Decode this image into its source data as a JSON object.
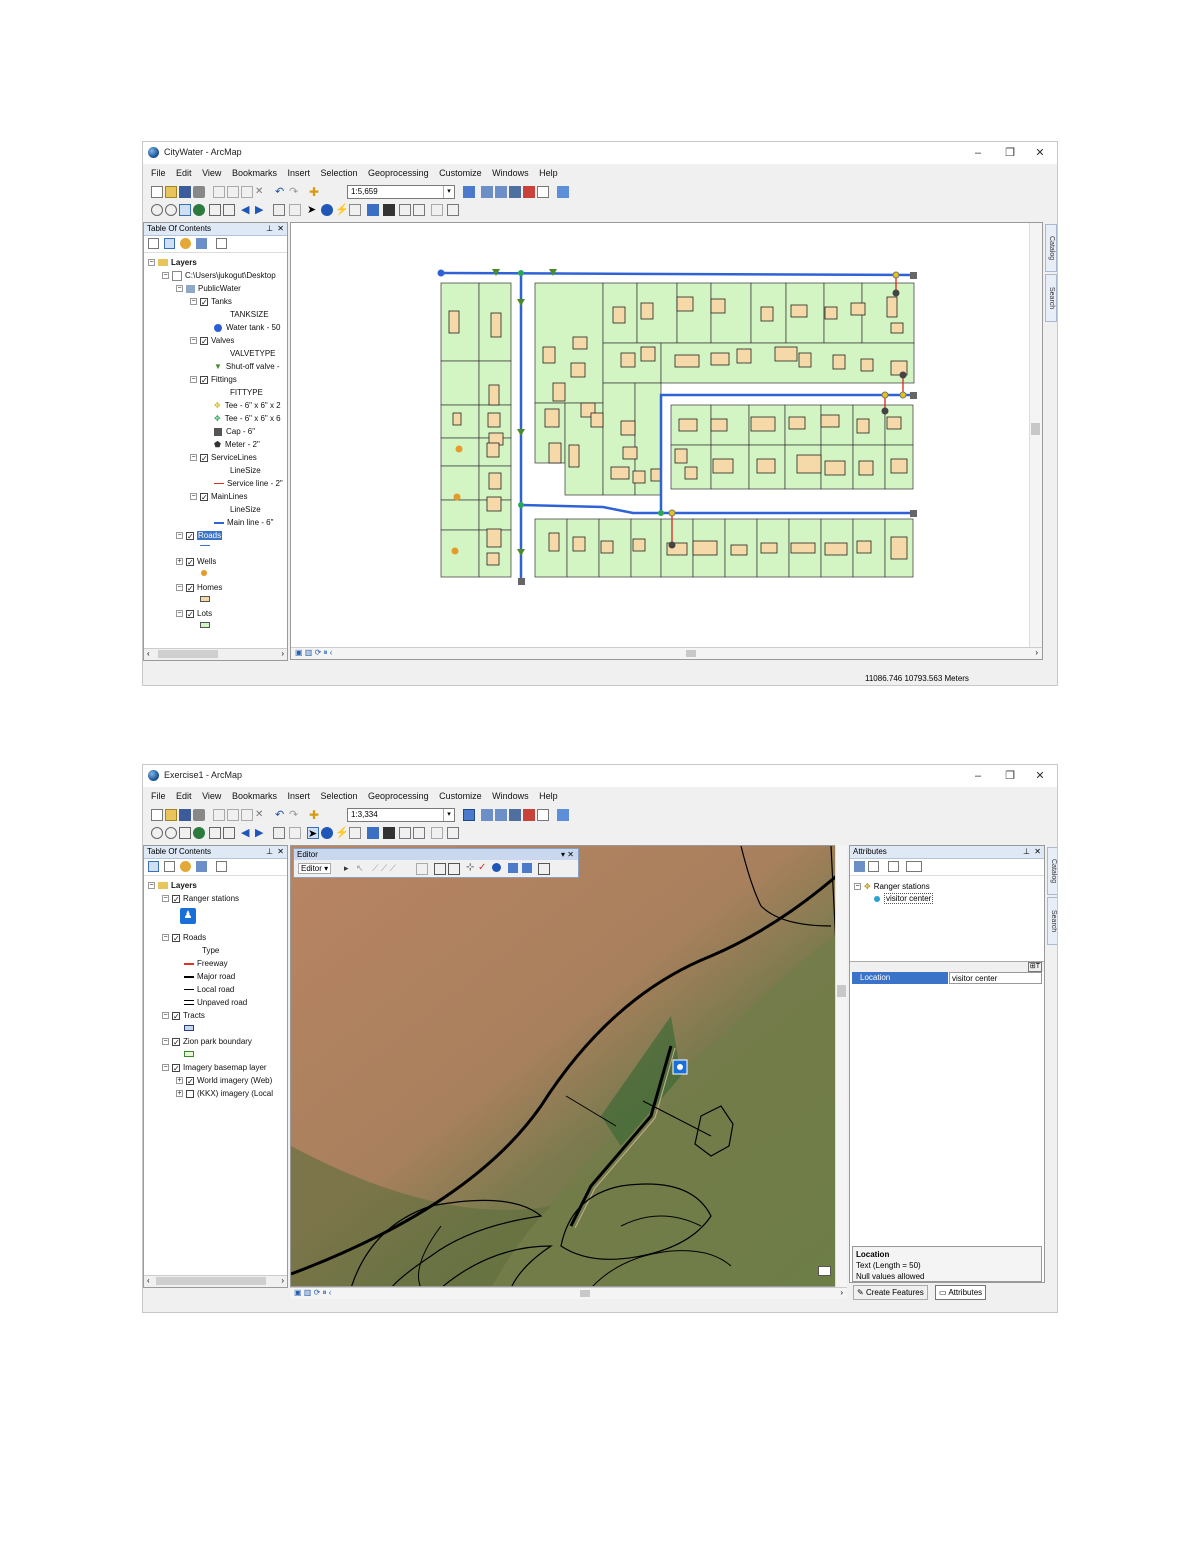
{
  "win1": {
    "title": "CityWater - ArcMap",
    "menu": [
      "File",
      "Edit",
      "View",
      "Bookmarks",
      "Insert",
      "Selection",
      "Geoprocessing",
      "Customize",
      "Windows",
      "Help"
    ],
    "scale": "1:5,659",
    "toc_title": "Table Of Contents",
    "toc": {
      "layers": "Layers",
      "path": "C:\\Users\\jukogut\\Desktop",
      "publicwater": "PublicWater",
      "tanks": "Tanks",
      "tanksize": "TANKSIZE",
      "water_tank": "Water tank - 50",
      "valves": "Valves",
      "valvetype": "VALVETYPE",
      "shutoff": "Shut-off valve -",
      "fittings": "Fittings",
      "fittype": "FITTYPE",
      "tee1": "Tee - 6\" x 6\" x 2",
      "tee2": "Tee - 6\" x 6\" x 6",
      "cap": "Cap - 6\"",
      "meter": "Meter - 2\"",
      "servicelines": "ServiceLines",
      "linesize1": "LineSize",
      "serviceline": "Service line - 2\"",
      "mainlines": "MainLines",
      "linesize2": "LineSize",
      "mainline": "Main line - 6\"",
      "roads": "Roads",
      "wells": "Wells",
      "homes": "Homes",
      "lots": "Lots"
    },
    "status": "11086.746 10793.563 Meters",
    "vtabs": [
      "Catalog",
      "Search"
    ]
  },
  "win2": {
    "title": "Exercise1 - ArcMap",
    "menu": [
      "File",
      "Edit",
      "View",
      "Bookmarks",
      "Insert",
      "Selection",
      "Geoprocessing",
      "Customize",
      "Windows",
      "Help"
    ],
    "scale": "1:3,334",
    "toc_title": "Table Of Contents",
    "toc": {
      "layers": "Layers",
      "ranger": "Ranger stations",
      "roads": "Roads",
      "type": "Type",
      "freeway": "Freeway",
      "major": "Major road",
      "local": "Local road",
      "unpaved": "Unpaved road",
      "tracts": "Tracts",
      "zion": "Zion park boundary",
      "imagery": "Imagery basemap layer",
      "world": "World imagery (Web)",
      "kkxk": "(KKX) imagery (Local"
    },
    "editor_title": "Editor",
    "editor_menu": "Editor ▾",
    "attr_title": "Attributes",
    "attr_tree_layer": "Ranger stations",
    "attr_tree_feature": "visitor center",
    "attr_field": "Location",
    "attr_value": "visitor center",
    "attr_desc_title": "Location",
    "attr_desc_type": "Text (Length = 50)",
    "attr_desc_null": "Null values allowed",
    "tab_create": "Create Features",
    "tab_attr": "Attributes",
    "vtabs": [
      "Catalog",
      "Search"
    ]
  },
  "colors": {
    "lot_fill": "#d3f5c3",
    "home_fill": "#f6d9a8",
    "main_line": "#2f62d6",
    "service_line": "#e0302a",
    "valve": "#4b8a2a",
    "well": "#e79a2a",
    "imagery_red": "#b98463",
    "imagery_green": "#6e7e47"
  }
}
